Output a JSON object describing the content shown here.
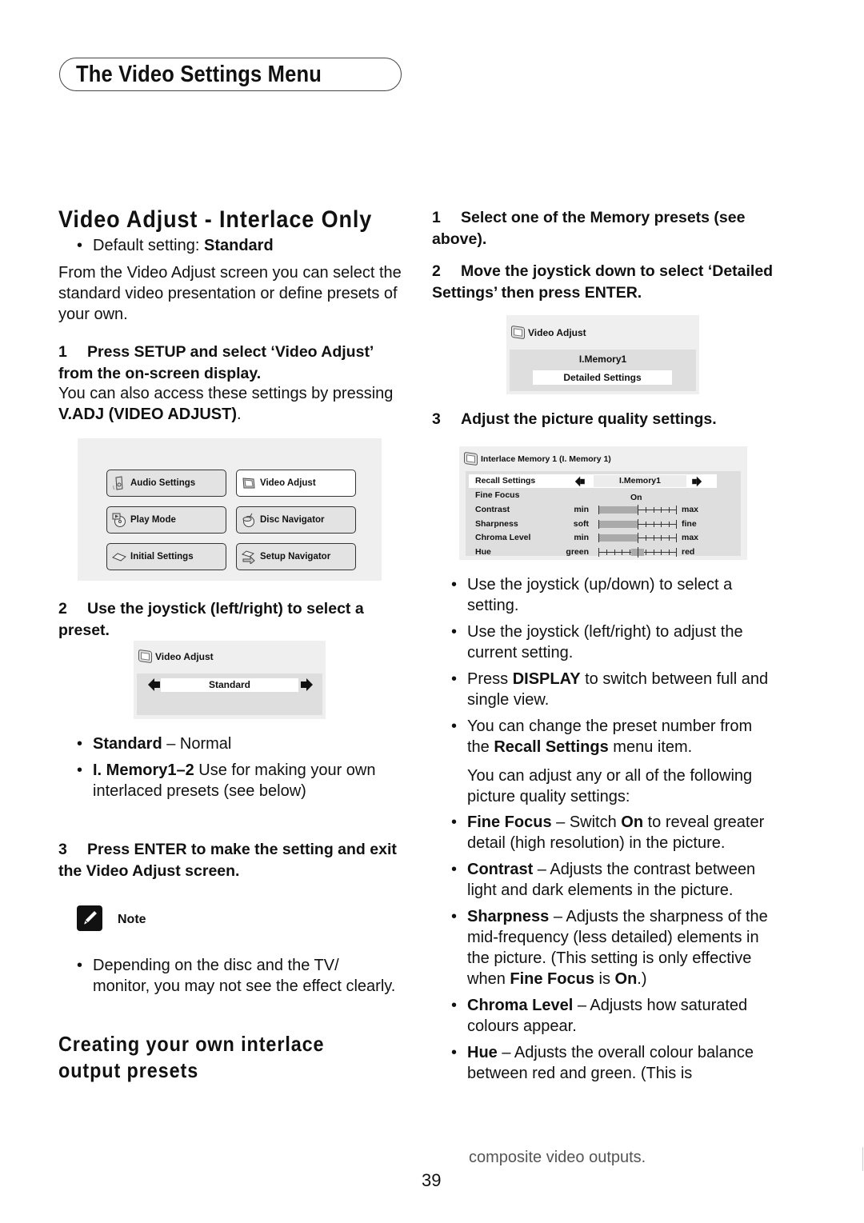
{
  "section_header": "The Video Settings Menu",
  "left": {
    "heading": "Video Adjust - Interlace Only",
    "default_setting": {
      "label": "Default setting:",
      "value": "Standard"
    },
    "intro": "From the Video Adjust screen you can select the standard video presentation or define presets of your own.",
    "step1": {
      "num": "1",
      "text": "Press SETUP and select ‘Video Adjust’ from the on-screen display."
    },
    "step1_detail": {
      "before": "You can also access these settings by pressing ",
      "bold": "V.ADJ (VIDEO ADJUST)",
      "after": "."
    },
    "main_menu": {
      "items": [
        {
          "label": "Audio Settings",
          "icon": "speaker-icon",
          "selected": false
        },
        {
          "label": "Video Adjust",
          "icon": "tv-icon",
          "selected": true
        },
        {
          "label": "Play Mode",
          "icon": "play-disc-icon",
          "selected": false
        },
        {
          "label": "Disc Navigator",
          "icon": "disc-navigator-icon",
          "selected": false
        },
        {
          "label": "Initial Settings",
          "icon": "initial-settings-icon",
          "selected": false
        },
        {
          "label": "Setup Navigator",
          "icon": "setup-navigator-icon",
          "selected": false
        }
      ]
    },
    "step2": {
      "num": "2",
      "text": "Use the joystick (left/right) to select a preset."
    },
    "preset_osd": {
      "title": "Video Adjust",
      "value": "Standard"
    },
    "presets": [
      {
        "bold": "Standard",
        "text": " – Normal"
      },
      {
        "bold": "I. Memory1–2",
        "text": " Use for making your own interlaced presets (see below)"
      }
    ],
    "step3": {
      "num": "3",
      "text": "Press ENTER to make the setting and exit the Video Adjust screen."
    },
    "note": {
      "title": "Note",
      "text": "Depending on the disc and the TV/ monitor, you may not see the effect clearly."
    },
    "subheading": "Creating your own interlace output presets"
  },
  "right": {
    "step1": {
      "num": "1",
      "text": "Select one of the Memory presets (see above)."
    },
    "step2": {
      "num": "2",
      "text": "Move the joystick down to select ‘Detailed Settings’ then press ENTER."
    },
    "memory_osd": {
      "title": "Video Adjust",
      "value": "I.Memory1",
      "button": "Detailed Settings"
    },
    "step3": {
      "num": "3",
      "text": "Adjust the picture quality settings."
    },
    "detail_osd": {
      "title": "Interlace Memory 1 (I. Memory 1)",
      "recall": {
        "label": "Recall Settings",
        "value": "I.Memory1"
      },
      "fine_focus": {
        "label": "Fine Focus",
        "value": "On"
      },
      "sliders": [
        {
          "label": "Contrast",
          "low": "min",
          "high": "max",
          "type": "fill",
          "value_percent": 50
        },
        {
          "label": "Sharpness",
          "low": "soft",
          "high": "fine",
          "type": "fill",
          "value_percent": 50
        },
        {
          "label": "Chroma Level",
          "low": "min",
          "high": "max",
          "type": "fill",
          "value_percent": 50
        },
        {
          "label": "Hue",
          "low": "green",
          "high": "red",
          "type": "center",
          "value_percent": 50
        }
      ]
    },
    "bullets": [
      {
        "parts": [
          {
            "t": "Use the joystick (up/down) to select a setting."
          }
        ]
      },
      {
        "parts": [
          {
            "t": "Use the joystick (left/right) to adjust the current setting."
          }
        ]
      },
      {
        "parts": [
          {
            "t": "Press "
          },
          {
            "b": "DISPLAY"
          },
          {
            "t": " to switch between full and single view."
          }
        ]
      },
      {
        "parts": [
          {
            "t": "You can change the preset number from the "
          },
          {
            "b": "Recall Settings"
          },
          {
            "t": " menu item."
          }
        ]
      }
    ],
    "adjust_intro": "You can adjust any or all of the following picture quality settings:",
    "settings_desc": [
      {
        "parts": [
          {
            "b": "Fine Focus"
          },
          {
            "t": " – Switch "
          },
          {
            "b": "On"
          },
          {
            "t": " to reveal greater detail (high resolution) in the picture."
          }
        ]
      },
      {
        "parts": [
          {
            "b": "Contrast"
          },
          {
            "t": " – Adjusts the contrast between light and dark elements in the picture."
          }
        ]
      },
      {
        "parts": [
          {
            "b": "Sharpness"
          },
          {
            "t": " – Adjusts the sharpness of the mid-frequency (less detailed) elements in the picture. (This setting is only effective when "
          },
          {
            "b": "Fine Focus"
          },
          {
            "t": " is "
          },
          {
            "b": "On"
          },
          {
            "t": ".)"
          }
        ]
      },
      {
        "parts": [
          {
            "b": "Chroma Level"
          },
          {
            "t": " – Adjusts how saturated colours appear."
          }
        ]
      },
      {
        "parts": [
          {
            "b": "Hue"
          },
          {
            "t": " – Adjusts the overall colour balance between red and green. (This is"
          }
        ]
      }
    ],
    "footer_fragment": "composite video outputs."
  },
  "page_number": "39"
}
